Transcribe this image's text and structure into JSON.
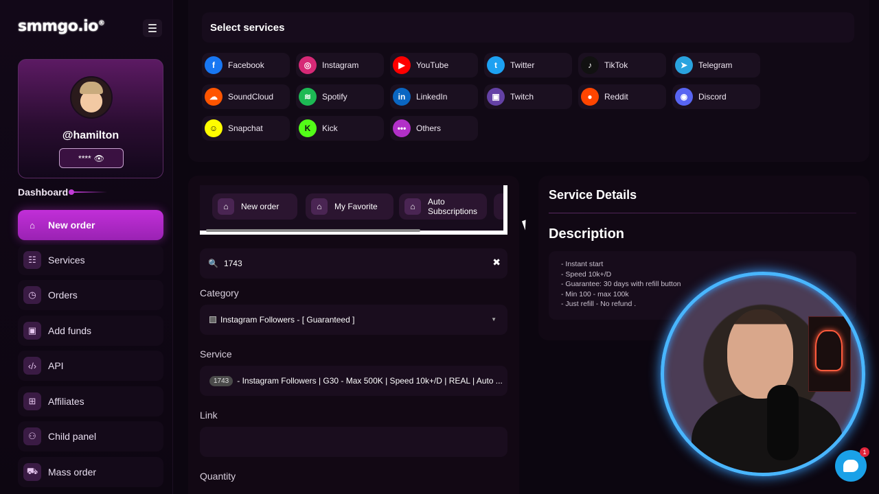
{
  "brand": {
    "logo_text": "smmgo.io",
    "logo_sup": "®"
  },
  "profile": {
    "username": "@hamilton",
    "balance_masked": "****",
    "balance_eye": "👁"
  },
  "sidebar": {
    "section_label": "Dashboard",
    "items": [
      {
        "label": "New order",
        "icon": "home-icon",
        "active": true
      },
      {
        "label": "Services",
        "icon": "list-icon"
      },
      {
        "label": "Orders",
        "icon": "clock-icon"
      },
      {
        "label": "Add funds",
        "icon": "wallet-icon"
      },
      {
        "label": "API",
        "icon": "code-icon"
      },
      {
        "label": "Affiliates",
        "icon": "gift-icon"
      },
      {
        "label": "Child panel",
        "icon": "user-icon"
      },
      {
        "label": "Mass order",
        "icon": "cart-icon"
      }
    ]
  },
  "services": {
    "title": "Select services",
    "platforms": [
      {
        "label": "Facebook",
        "icon": "facebook-icon",
        "color": "#1877f2",
        "glyph": "f"
      },
      {
        "label": "Instagram",
        "icon": "instagram-icon",
        "color": "#d62976",
        "glyph": "◎"
      },
      {
        "label": "YouTube",
        "icon": "youtube-icon",
        "color": "#ff0000",
        "glyph": "▶"
      },
      {
        "label": "Twitter",
        "icon": "twitter-icon",
        "color": "#1da1f2",
        "glyph": "t"
      },
      {
        "label": "TikTok",
        "icon": "tiktok-icon",
        "color": "#111111",
        "glyph": "♪"
      },
      {
        "label": "Telegram",
        "icon": "telegram-icon",
        "color": "#2aa3df",
        "glyph": "➤"
      },
      {
        "label": "SoundCloud",
        "icon": "soundcloud-icon",
        "color": "#ff5500",
        "glyph": "☁"
      },
      {
        "label": "Spotify",
        "icon": "spotify-icon",
        "color": "#1db954",
        "glyph": "≋"
      },
      {
        "label": "LinkedIn",
        "icon": "linkedin-icon",
        "color": "#0a66c2",
        "glyph": "in"
      },
      {
        "label": "Twitch",
        "icon": "twitch-icon",
        "color": "#6441a5",
        "glyph": "▣"
      },
      {
        "label": "Reddit",
        "icon": "reddit-icon",
        "color": "#ff4500",
        "glyph": "●"
      },
      {
        "label": "Discord",
        "icon": "discord-icon",
        "color": "#5865f2",
        "glyph": "◉"
      },
      {
        "label": "Snapchat",
        "icon": "snapchat-icon",
        "color": "#fffc00",
        "glyph": "☺"
      },
      {
        "label": "Kick",
        "icon": "kick-icon",
        "color": "#53fc18",
        "glyph": "K"
      },
      {
        "label": "Others",
        "icon": "more-icon",
        "color": "#b230c8",
        "glyph": "•••"
      }
    ]
  },
  "order": {
    "tabs": [
      {
        "label": "New order",
        "icon": "home-icon"
      },
      {
        "label": "My Favorite",
        "icon": "home-icon"
      },
      {
        "label": "Auto Subscriptions",
        "icon": "home-icon"
      }
    ],
    "search_value": "1743",
    "category_label": "Category",
    "category_value": "Instagram Followers - [ Guaranteed ]",
    "service_label": "Service",
    "service_id": "1743",
    "service_value": "- Instagram Followers | G30 - Max 500K | Speed 10k+/D | REAL | Auto ...",
    "link_label": "Link",
    "link_value": "",
    "quantity_label": "Quantity"
  },
  "details": {
    "title": "Service Details",
    "description_title": "Description",
    "description_lines": [
      "- Instant start",
      "- Speed 10k+/D",
      "- Guarantee: 30 days with refill button",
      "- Min 100 - max 100k",
      "- Just refill - No refund ."
    ]
  },
  "chat": {
    "badge": "1"
  }
}
